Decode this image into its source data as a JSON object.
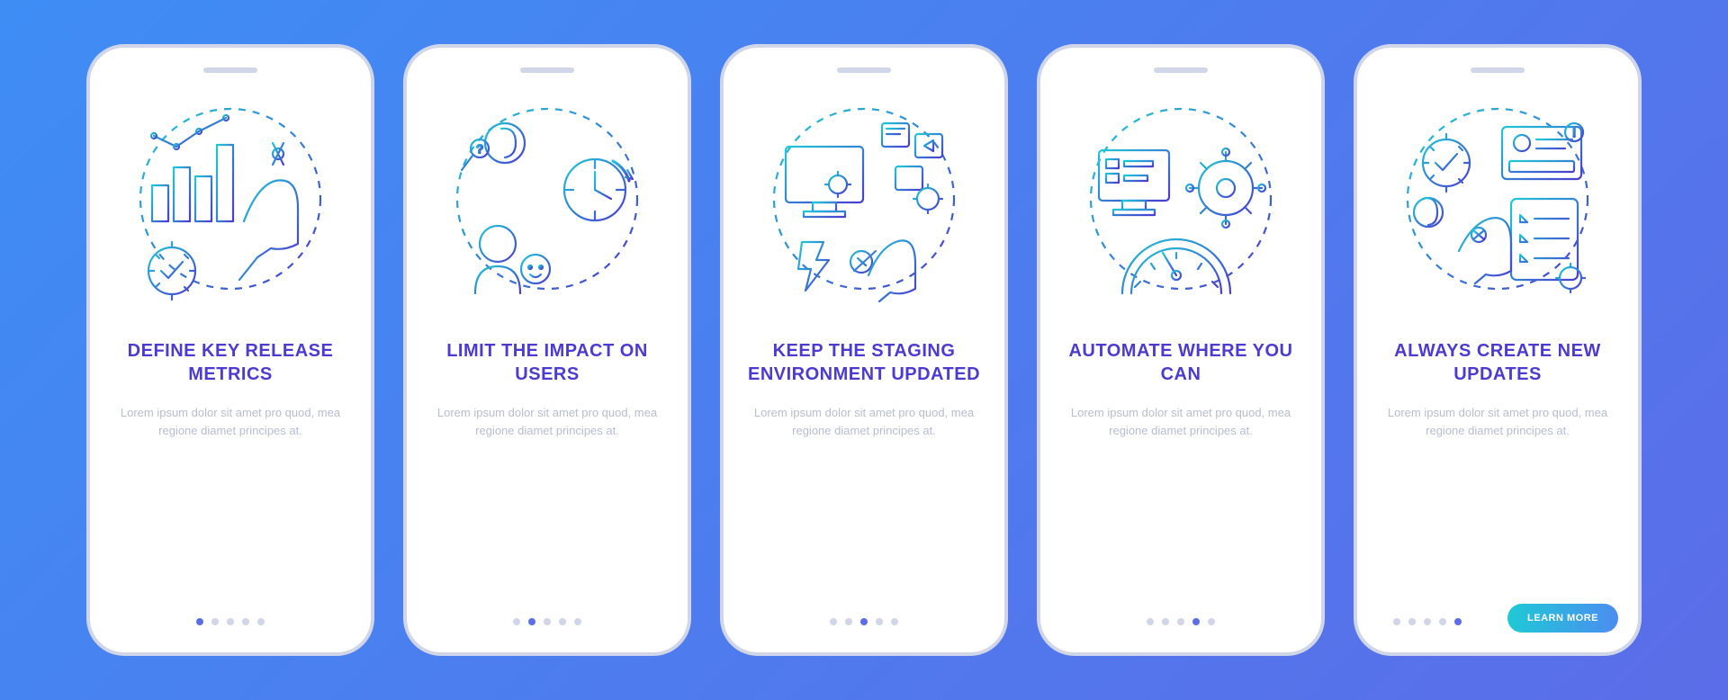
{
  "screens": [
    {
      "title": "DEFINE KEY RELEASE METRICS",
      "desc": "Lorem ipsum dolor sit amet pro quod, mea regione diamet principes at.",
      "cta": null,
      "active": 0
    },
    {
      "title": "LIMIT THE IMPACT ON USERS",
      "desc": "Lorem ipsum dolor sit amet pro quod, mea regione diamet principes at.",
      "cta": null,
      "active": 1
    },
    {
      "title": "KEEP THE STAGING ENVIRONMENT UPDATED",
      "desc": "Lorem ipsum dolor sit amet pro quod, mea regione diamet principes at.",
      "cta": null,
      "active": 2
    },
    {
      "title": "AUTOMATE WHERE YOU CAN",
      "desc": "Lorem ipsum dolor sit amet pro quod, mea regione diamet principes at.",
      "cta": null,
      "active": 3
    },
    {
      "title": "ALWAYS CREATE NEW UPDATES",
      "desc": "Lorem ipsum dolor sit amet pro quod, mea regione diamet principes at.",
      "cta": "LEARN MORE",
      "active": 4
    }
  ],
  "dotCount": 5
}
